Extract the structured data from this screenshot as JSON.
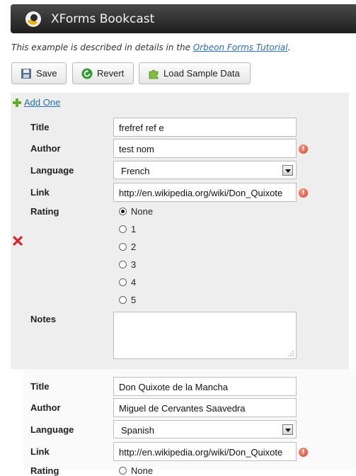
{
  "app": {
    "title": "XForms Bookcast"
  },
  "description": {
    "text": "This example is described in details in the ",
    "link": "Orbeon Forms Tutorial",
    "tail": "."
  },
  "toolbar": {
    "save": "Save",
    "revert": "Revert",
    "load": "Load Sample Data"
  },
  "add_one": "Add One",
  "labels": {
    "title": "Title",
    "author": "Author",
    "language": "Language",
    "link": "Link",
    "rating": "Rating",
    "notes": "Notes"
  },
  "books": [
    {
      "title": "frefref ref e",
      "author": "test nom",
      "language": "French",
      "link": "http://en.wikipedia.org/wiki/Don_Quixote",
      "rating_options": [
        "None",
        "1",
        "2",
        "3",
        "4",
        "5"
      ],
      "rating_selected": "None",
      "notes": "",
      "author_error": true,
      "link_error": true
    },
    {
      "title": "Don Quixote de la Mancha",
      "author": "Miguel de Cervantes Saavedra",
      "language": "Spanish",
      "link": "http://en.wikipedia.org/wiki/Don_Quixote",
      "rating_visible": "None",
      "link_error": true
    }
  ],
  "error_glyph": "!",
  "colors": {
    "link": "#2a6fb0",
    "error": "#d9412a",
    "titlebar": "#2e2e2e"
  }
}
